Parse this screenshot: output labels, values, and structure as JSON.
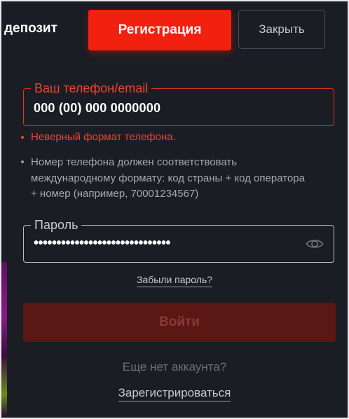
{
  "header": {
    "deposit_label": "депозит",
    "register_button": "Регистрация",
    "close_button": "Закрыть"
  },
  "form": {
    "phone": {
      "label": "Ваш телефон/email",
      "value": "000 (00) 000 0000000",
      "error": "Неверный формат телефона.",
      "hint": "Номер телефона должен соответствовать международному формату: код страны + код оператора + номер (например, 70001234567)"
    },
    "password": {
      "label": "Пароль",
      "value": "••••••••••••••••••••••••••••••",
      "toggle_icon": "eye-icon"
    },
    "forgot_password": "Забыли пароль?",
    "login_button": "Войти",
    "no_account_text": "Еще нет аккаунта?",
    "register_link": "Зарегистрироваться"
  },
  "colors": {
    "background": "#1b1d24",
    "accent": "#f2200e",
    "error": "#f0442e",
    "login_disabled": "#5a1714"
  }
}
